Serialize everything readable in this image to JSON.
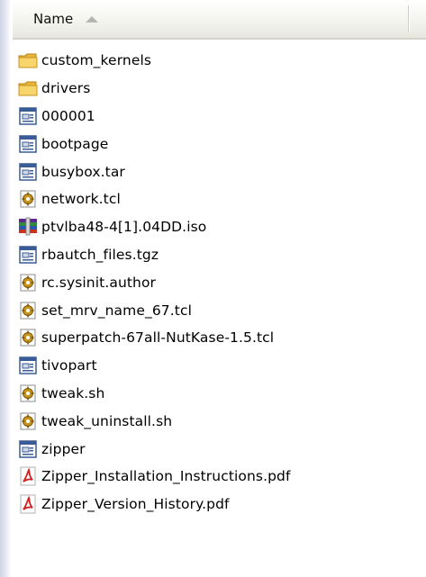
{
  "header": {
    "name_label": "Name",
    "sort_direction": "ascending"
  },
  "files": [
    {
      "name": "custom_kernels",
      "icon": "folder-icon"
    },
    {
      "name": "drivers",
      "icon": "folder-icon"
    },
    {
      "name": "000001",
      "icon": "generic-file-icon"
    },
    {
      "name": "bootpage",
      "icon": "generic-file-icon"
    },
    {
      "name": "busybox.tar",
      "icon": "generic-file-icon"
    },
    {
      "name": "network.tcl",
      "icon": "script-file-icon"
    },
    {
      "name": "ptvlba48-4[1].04DD.iso",
      "icon": "archive-file-icon"
    },
    {
      "name": "rbautch_files.tgz",
      "icon": "generic-file-icon"
    },
    {
      "name": "rc.sysinit.author",
      "icon": "script-file-icon"
    },
    {
      "name": "set_mrv_name_67.tcl",
      "icon": "script-file-icon"
    },
    {
      "name": "superpatch-67all-NutKase-1.5.tcl",
      "icon": "script-file-icon"
    },
    {
      "name": "tivopart",
      "icon": "generic-file-icon"
    },
    {
      "name": "tweak.sh",
      "icon": "script-file-icon"
    },
    {
      "name": "tweak_uninstall.sh",
      "icon": "script-file-icon"
    },
    {
      "name": "zipper",
      "icon": "generic-file-icon"
    },
    {
      "name": "Zipper_Installation_Instructions.pdf",
      "icon": "pdf-file-icon"
    },
    {
      "name": "Zipper_Version_History.pdf",
      "icon": "pdf-file-icon"
    }
  ],
  "colors": {
    "folder": "#f2c94c",
    "pdf_red": "#d11f1f",
    "generic_blue": "#3a5c96"
  }
}
